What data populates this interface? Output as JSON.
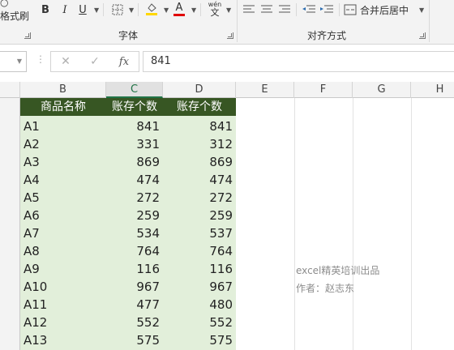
{
  "ribbon": {
    "format_painter_partial": "格式刷",
    "bold": "B",
    "italic": "I",
    "underline": "U",
    "font_color_glyph": "A",
    "phonetic_glyph": "文",
    "phonetic_top": "wén",
    "merge_center": "合并后居中",
    "font_group_label": "字体",
    "align_group_label": "对齐方式"
  },
  "formula_bar": {
    "name_box": "",
    "cancel": "✕",
    "enter": "✓",
    "fx": "fx",
    "value": "841"
  },
  "columns": [
    "B",
    "C",
    "D",
    "E",
    "F",
    "G",
    "H"
  ],
  "selected_column": "C",
  "table": {
    "headers": [
      "商品名称",
      "账存个数",
      "账存个数"
    ],
    "rows": [
      [
        "A1",
        "841",
        "841"
      ],
      [
        "A2",
        "331",
        "312"
      ],
      [
        "A3",
        "869",
        "869"
      ],
      [
        "A4",
        "474",
        "474"
      ],
      [
        "A5",
        "272",
        "272"
      ],
      [
        "A6",
        "259",
        "259"
      ],
      [
        "A7",
        "534",
        "537"
      ],
      [
        "A8",
        "764",
        "764"
      ],
      [
        "A9",
        "116",
        "116"
      ],
      [
        "A10",
        "967",
        "967"
      ],
      [
        "A11",
        "477",
        "480"
      ],
      [
        "A12",
        "552",
        "552"
      ],
      [
        "A13",
        "575",
        "575"
      ]
    ]
  },
  "watermark": {
    "line1": "excel精英培训出品",
    "line2": "作者：赵志东"
  },
  "colors": {
    "header_fill": "#375623",
    "data_fill": "#e2efda",
    "accent": "#217346"
  }
}
